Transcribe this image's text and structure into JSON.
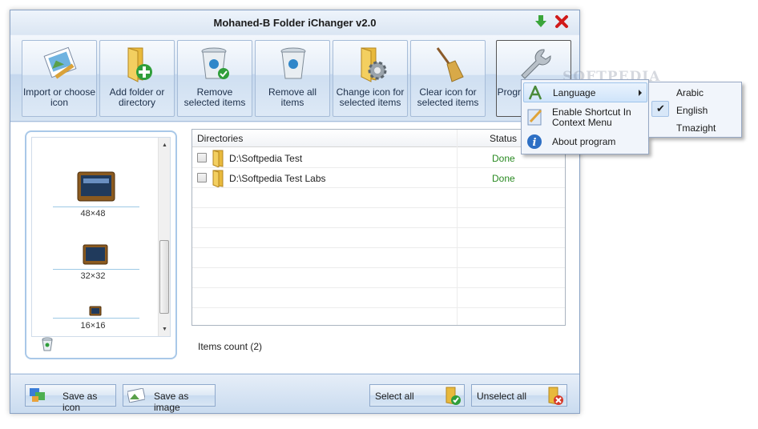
{
  "window": {
    "title": "Mohaned-B Folder iChanger v2.0"
  },
  "toolbar": {
    "buttons": [
      {
        "label": "Import or choose icon",
        "icon": "image-pencil-icon"
      },
      {
        "label": "Add folder or directory",
        "icon": "folder-add-icon"
      },
      {
        "label": "Remove selected items",
        "icon": "recycle-bin-check-icon"
      },
      {
        "label": "Remove all items",
        "icon": "recycle-bin-icon"
      },
      {
        "label": "Change icon for selected items",
        "icon": "folder-gear-icon"
      },
      {
        "label": "Clear icon for selected items",
        "icon": "broom-icon"
      },
      {
        "label": "Program settings",
        "icon": "wrench-icon"
      }
    ]
  },
  "preview": {
    "sizes": [
      "48×48",
      "32×32",
      "16×16"
    ]
  },
  "list": {
    "columns": [
      "Directories",
      "Status"
    ],
    "rows": [
      {
        "path": "D:\\Softpedia Test",
        "status": "Done"
      },
      {
        "path": "D:\\Softpedia Test Labs",
        "status": "Done"
      }
    ],
    "count_label": "Items count (2)"
  },
  "bottom": {
    "save_icon": "Save as icon",
    "save_image": "Save as image",
    "select_all": "Select all",
    "unselect_all": "Unselect all"
  },
  "menu": {
    "items": [
      {
        "label": "Language",
        "icon": "letter-a-icon"
      },
      {
        "label": "Enable Shortcut In Context Menu",
        "icon": "pencil-doc-icon"
      },
      {
        "label": "About program",
        "icon": "info-icon"
      }
    ],
    "languages": [
      "Arabic",
      "English",
      "Tmazight"
    ],
    "selected_language": "English"
  },
  "watermark": "SOFTPEDIA",
  "colors": {
    "accent": "#c5d8ee",
    "status_done": "#2a8a22",
    "close": "#d11a1a",
    "minimize": "#2a9b2a"
  }
}
